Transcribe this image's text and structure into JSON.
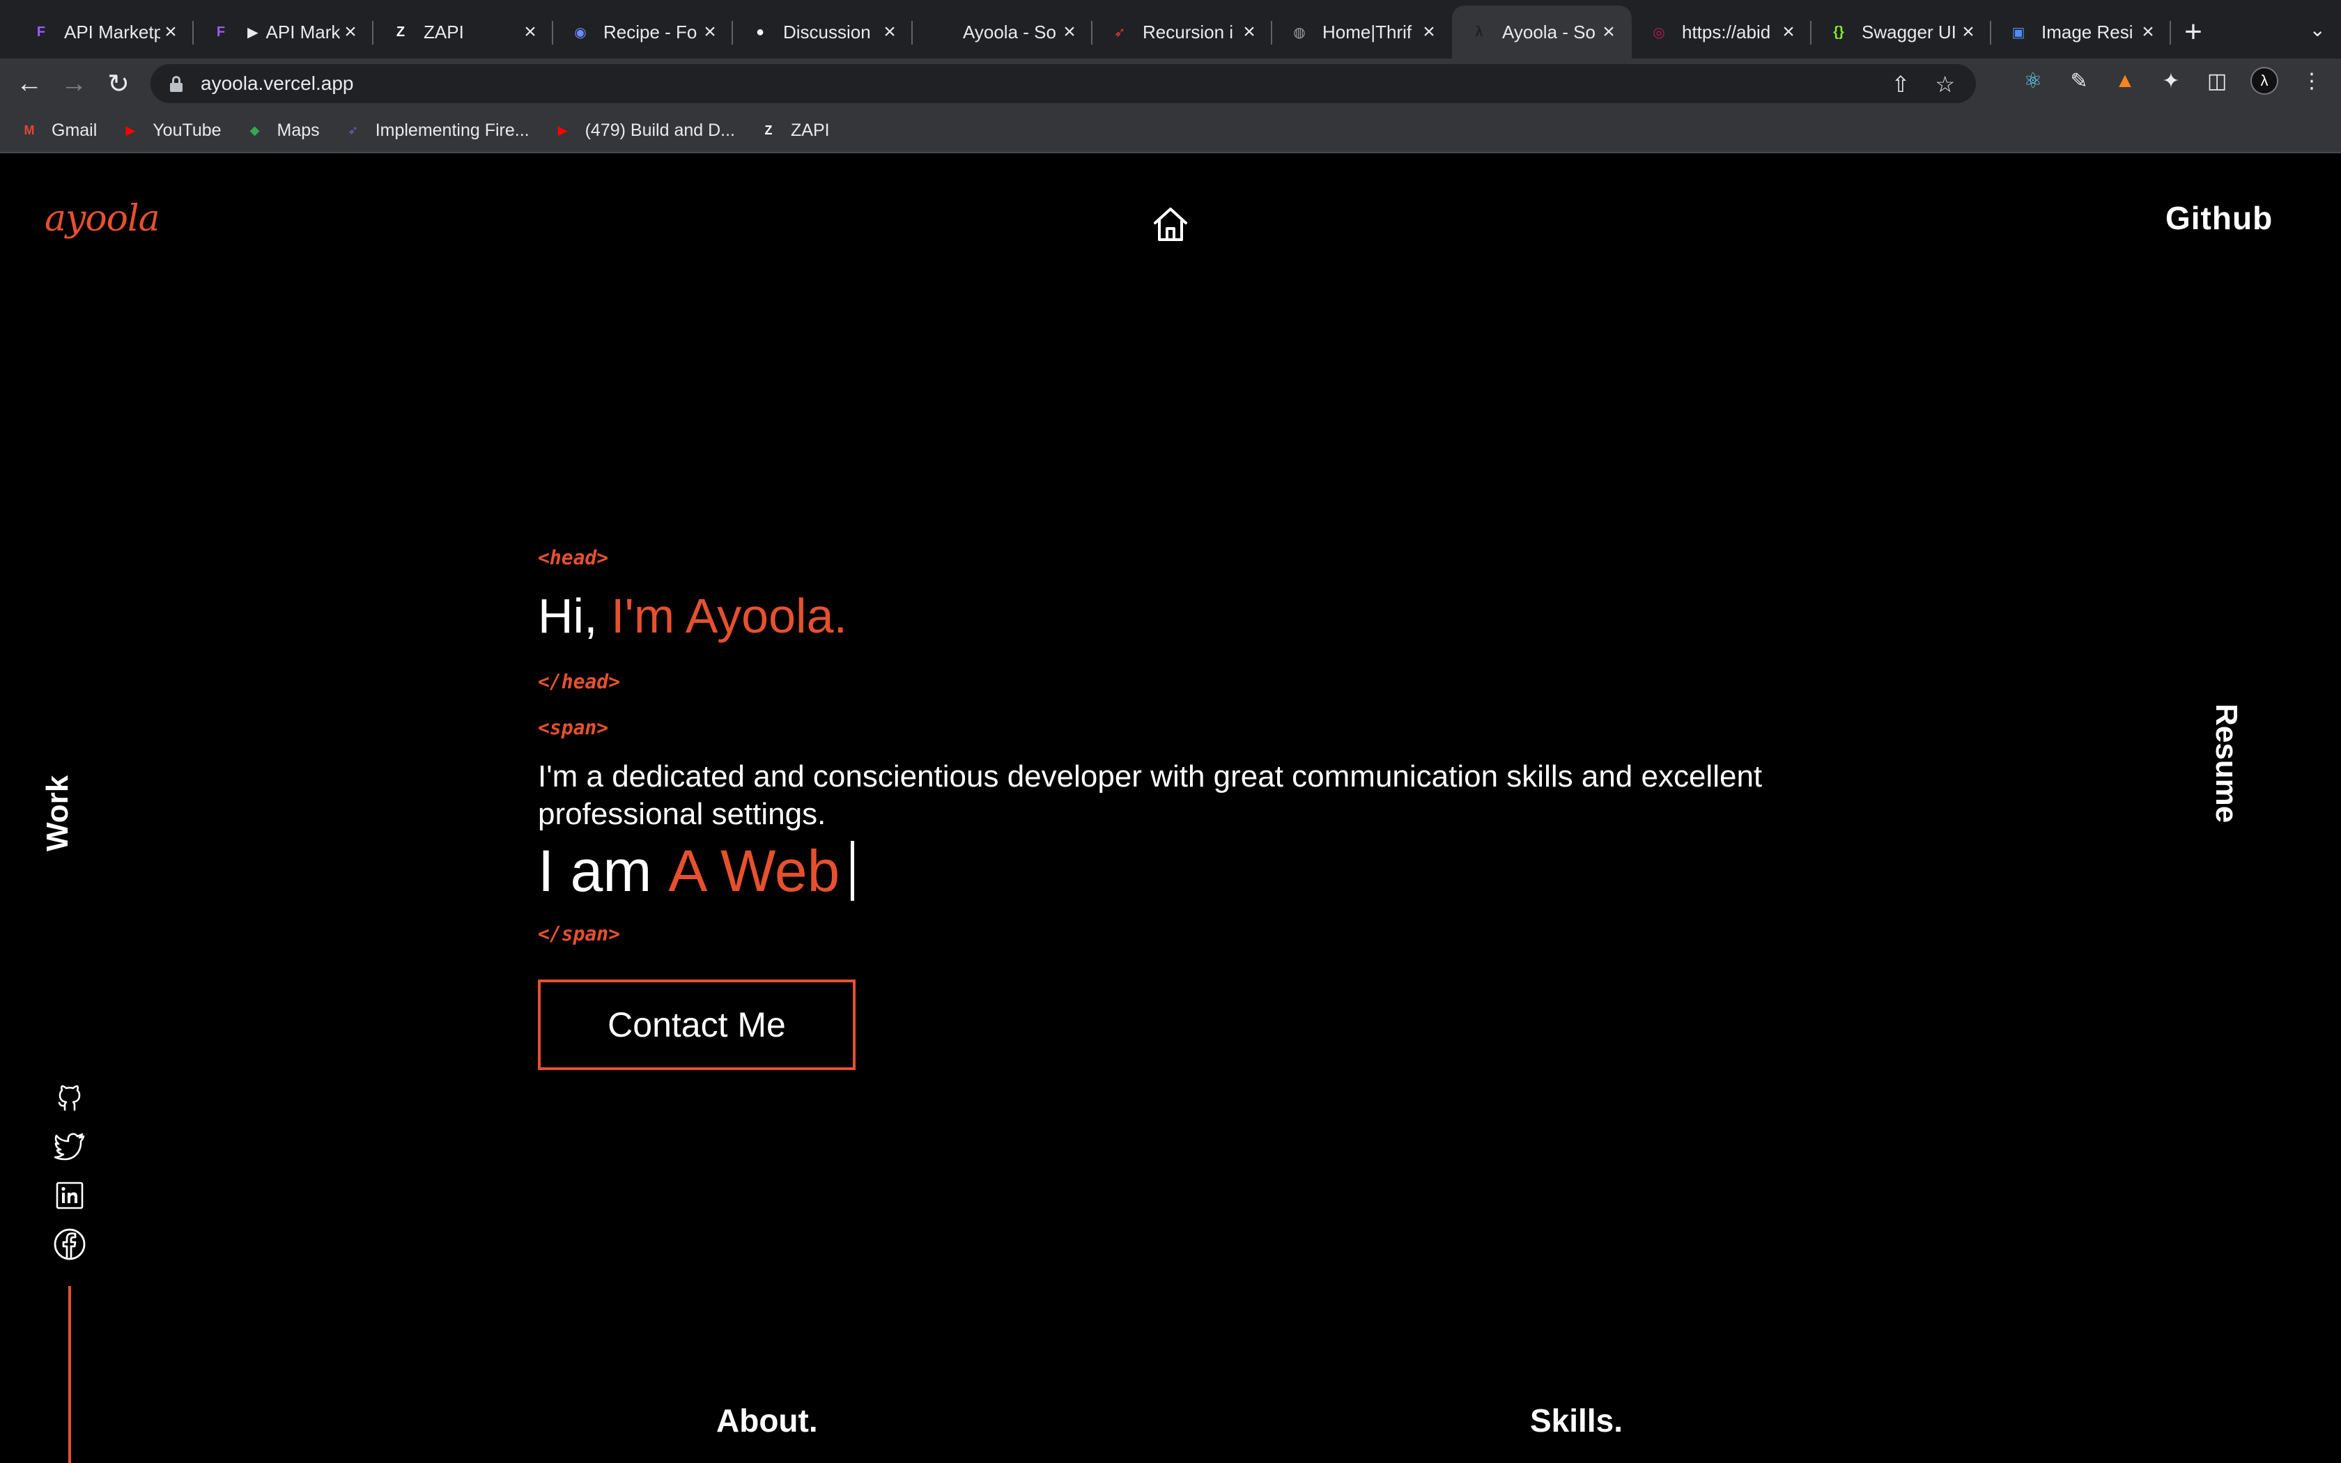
{
  "browser": {
    "tabs": [
      {
        "title": "API Marketp",
        "icon": "figma-icon",
        "icon_color": "#a259ff"
      },
      {
        "title": "► API Mark",
        "icon": "figma-icon",
        "icon_color": "#a259ff"
      },
      {
        "title": "ZAPI",
        "icon": "zapi-icon",
        "icon_color": "#ffffff"
      },
      {
        "title": "Recipe - Fo",
        "icon": "recipe-icon",
        "icon_color": "#6a8cff"
      },
      {
        "title": "Discussion",
        "icon": "github-icon",
        "icon_color": "#ffffff"
      },
      {
        "title": "Ayoola - So",
        "icon": "ayoola-icon",
        "icon_color": "#202124"
      },
      {
        "title": "Recursion i",
        "icon": "rocket-icon",
        "icon_color": "#e53935"
      },
      {
        "title": "Home|Thrif",
        "icon": "globe-icon",
        "icon_color": "#9aa0a6"
      },
      {
        "title": "Ayoola - So",
        "icon": "ayoola-icon",
        "icon_color": "#202124",
        "active": true
      },
      {
        "title": "https://abid",
        "icon": "circle-icon",
        "icon_color": "#c2185b"
      },
      {
        "title": "Swagger UI",
        "icon": "swagger-icon",
        "icon_color": "#85ea2d"
      },
      {
        "title": "Image Resi",
        "icon": "image-icon",
        "icon_color": "#4f8cf7"
      }
    ],
    "new_tab_label": "+",
    "url": "ayoola.vercel.app",
    "bookmarks": [
      {
        "label": "Gmail",
        "icon": "gmail-icon"
      },
      {
        "label": "YouTube",
        "icon": "youtube-icon"
      },
      {
        "label": "Maps",
        "icon": "maps-icon"
      },
      {
        "label": "Implementing Fire...",
        "icon": "rocket-icon"
      },
      {
        "label": "(479) Build and D...",
        "icon": "youtube-icon"
      },
      {
        "label": "ZAPI",
        "icon": "zapi-icon"
      }
    ]
  },
  "site": {
    "logo": "ayoola",
    "nav_right": "Github",
    "side_left": "Work",
    "side_right": "Resume",
    "head_open": "<head>",
    "greeting": "Hi,",
    "name": "I'm Ayoola.",
    "head_close": "</head>",
    "span_open": "<span>",
    "bio": "I'm a dedicated and conscientious developer with great communication skills and excellent professional settings.",
    "typing_prefix": "I am",
    "typing_value": "A Web",
    "span_close": "</span>",
    "cta": "Contact Me",
    "sections": [
      "About.",
      "Skills."
    ],
    "accent_color": "#e5512f",
    "social_icons": [
      "github-icon",
      "twitter-icon",
      "linkedin-icon",
      "facebook-icon"
    ]
  }
}
